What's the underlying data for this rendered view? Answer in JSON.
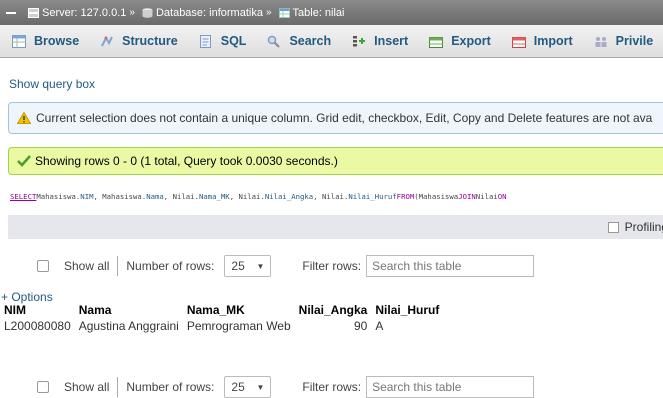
{
  "breadcrumb": {
    "server": "Server: 127.0.0.1",
    "database": "Database: informatika",
    "table": "Table: nilai",
    "separator": "»"
  },
  "tabs": [
    {
      "label": "Browse",
      "icon": "browse-icon"
    },
    {
      "label": "Structure",
      "icon": "structure-icon"
    },
    {
      "label": "SQL",
      "icon": "sql-icon"
    },
    {
      "label": "Search",
      "icon": "search-icon"
    },
    {
      "label": "Insert",
      "icon": "insert-icon"
    },
    {
      "label": "Export",
      "icon": "export-icon"
    },
    {
      "label": "Import",
      "icon": "import-icon"
    },
    {
      "label": "Privile",
      "icon": "privileges-icon"
    }
  ],
  "show_query_box": "Show query box",
  "notice": "Current selection does not contain a unique column. Grid edit, checkbox, Edit, Copy and Delete features are not ava",
  "success": "Showing rows 0 - 0 (1 total, Query took 0.0030 seconds.)",
  "sql": {
    "select": "SELECT",
    "part1": " Mahasiswa.",
    "c1": "NIM",
    "part2": ", Mahasiswa.",
    "c2": "Nama",
    "part3": ", Nilai.",
    "c3": "Nama_MK",
    "part4": ", Nilai.",
    "c4": "Nilai_Angka",
    "part5": ", Nilai.",
    "c5": "Nilai_Huruf",
    "from": " FROM",
    "part6": " (Mahasiswa ",
    "join": "JOIN",
    "part7": " Nilai ",
    "on": "ON"
  },
  "profiling": "Profiling",
  "navigation": {
    "show_all": "Show all",
    "rows_label": "Number of rows:",
    "rows_value": "25",
    "filter_label": "Filter rows:",
    "filter_placeholder": "Search this table"
  },
  "options": "+ Options",
  "table": {
    "headers": [
      "NIM",
      "Nama",
      "Nama_MK",
      "Nilai_Angka",
      "Nilai_Huruf"
    ],
    "rows": [
      [
        "L200080080",
        "Agustina Anggraini",
        "Pemrograman Web",
        "90",
        "A"
      ]
    ]
  },
  "colors": {
    "link": "#235a81",
    "success_bg": "#ebf8a4",
    "notice_bg": "#eef6fb",
    "breadcrumb_bg": "#7a7a7a"
  }
}
